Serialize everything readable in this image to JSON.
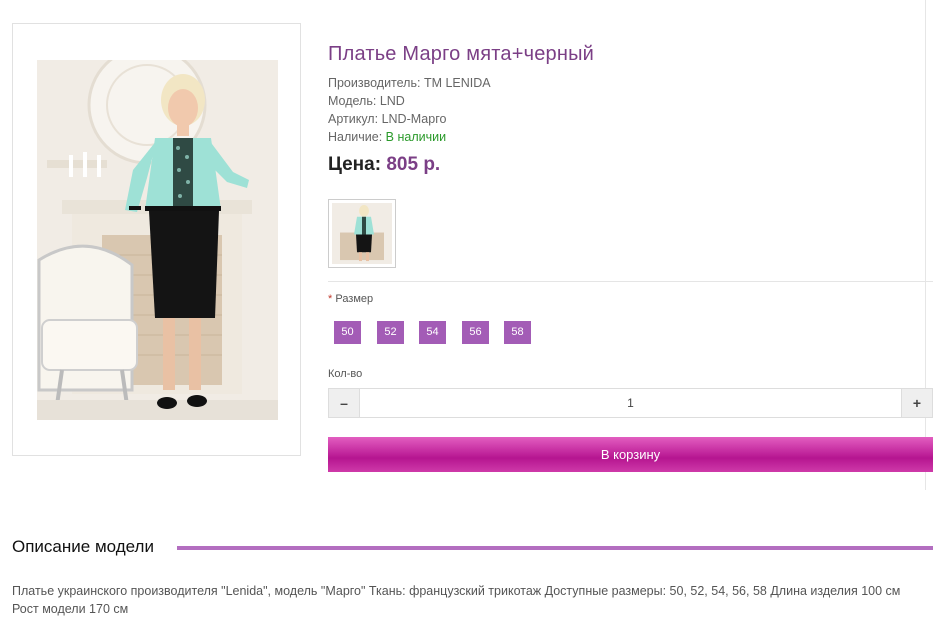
{
  "product": {
    "title": "Платье Марго мята+черный",
    "manufacturer_label": "Производитель:",
    "manufacturer": "TM LENIDA",
    "model_label": "Модель:",
    "model": "LND",
    "sku_label": "Артикул:",
    "sku": "LND-Марго",
    "availability_label": "Наличие:",
    "availability": "В наличии",
    "price_label": "Цена:",
    "price": "805 р."
  },
  "options": {
    "required_mark": "*",
    "size_label": "Размер",
    "sizes": [
      "50",
      "52",
      "54",
      "56",
      "58"
    ]
  },
  "quantity": {
    "label": "Кол-во",
    "value": "1",
    "minus_icon": "minus-icon",
    "plus_icon": "plus-icon"
  },
  "cart": {
    "button_label": "В корзину"
  },
  "description": {
    "heading": "Описание модели",
    "text": "Платье украинского производителя \"Lenida\", модель \"Марго\" Ткань: французский трикотаж Доступные размеры: 50, 52, 54, 56, 58 Длина изделия 100 см Рост модели 170 см"
  },
  "colors": {
    "accent_purple": "#7b3f86",
    "size_button": "#a35cb6",
    "cart_button": "#c2279d",
    "in_stock": "#2a9a2a"
  }
}
